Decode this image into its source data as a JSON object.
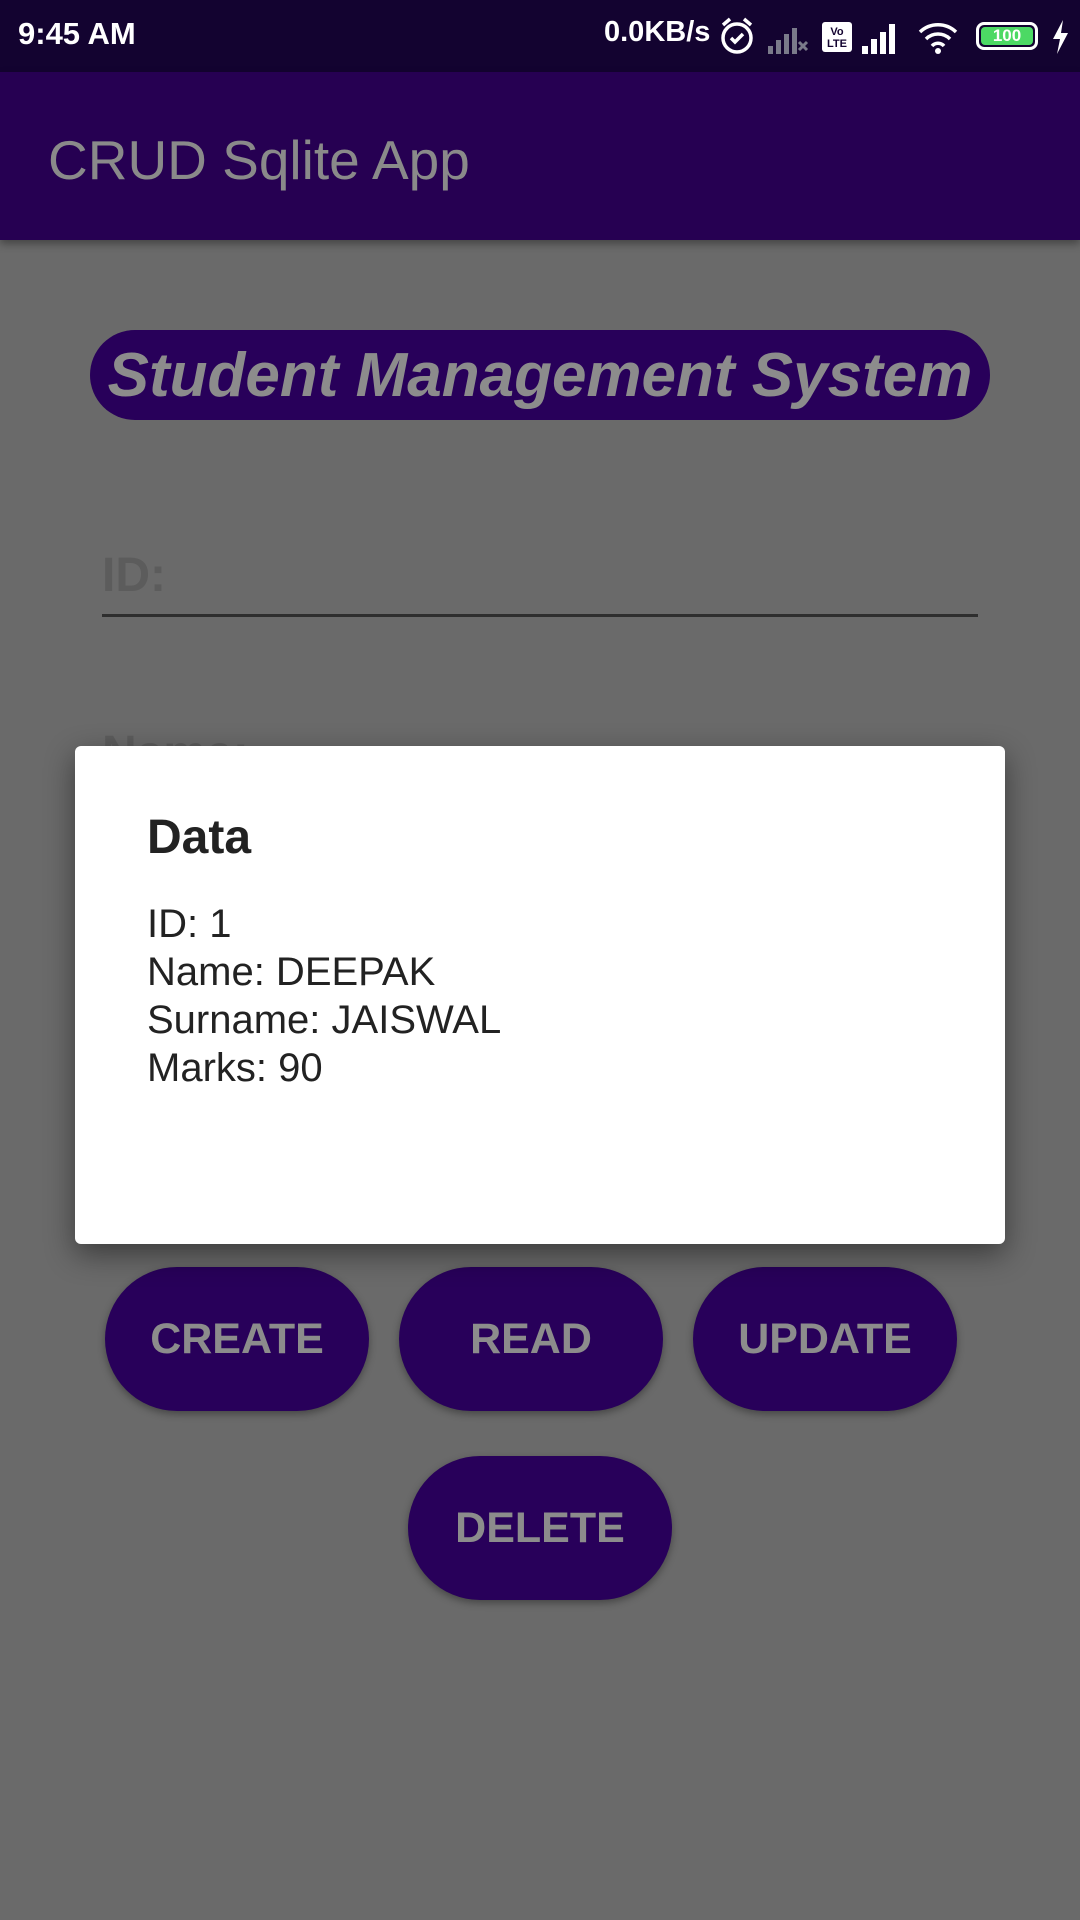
{
  "status_bar": {
    "time": "9:45 AM",
    "network_speed": "0.0KB/s",
    "battery": "100",
    "icons": [
      "alarm-icon",
      "signal-no-service-icon",
      "volte-icon",
      "signal-icon",
      "wifi-icon",
      "battery-icon",
      "charging-icon"
    ]
  },
  "app_bar": {
    "title": "CRUD Sqlite App"
  },
  "header": {
    "title": "Student Management System"
  },
  "form": {
    "id_label": "ID:",
    "name_label": "Name:"
  },
  "buttons": {
    "create": "CREATE",
    "read": "READ",
    "update": "UPDATE",
    "delete": "DELETE"
  },
  "dialog": {
    "title": "Data",
    "lines": [
      "ID: 1",
      "Name: DEEPAK",
      "Surname: JAISWAL",
      "Marks: 90"
    ]
  },
  "colors": {
    "status_bar": "#130330",
    "app_bar": "#260052",
    "primary": "#28005a",
    "scrim_background": "#6a6a6a",
    "dialog_background": "#ffffff"
  }
}
